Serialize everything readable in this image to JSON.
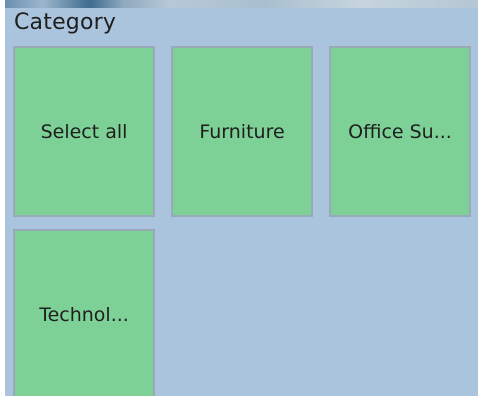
{
  "slicer": {
    "title": "Category",
    "items": [
      {
        "label": "Select all"
      },
      {
        "label": "Furniture"
      },
      {
        "label": "Office Su..."
      },
      {
        "label": "Technol..."
      }
    ]
  }
}
